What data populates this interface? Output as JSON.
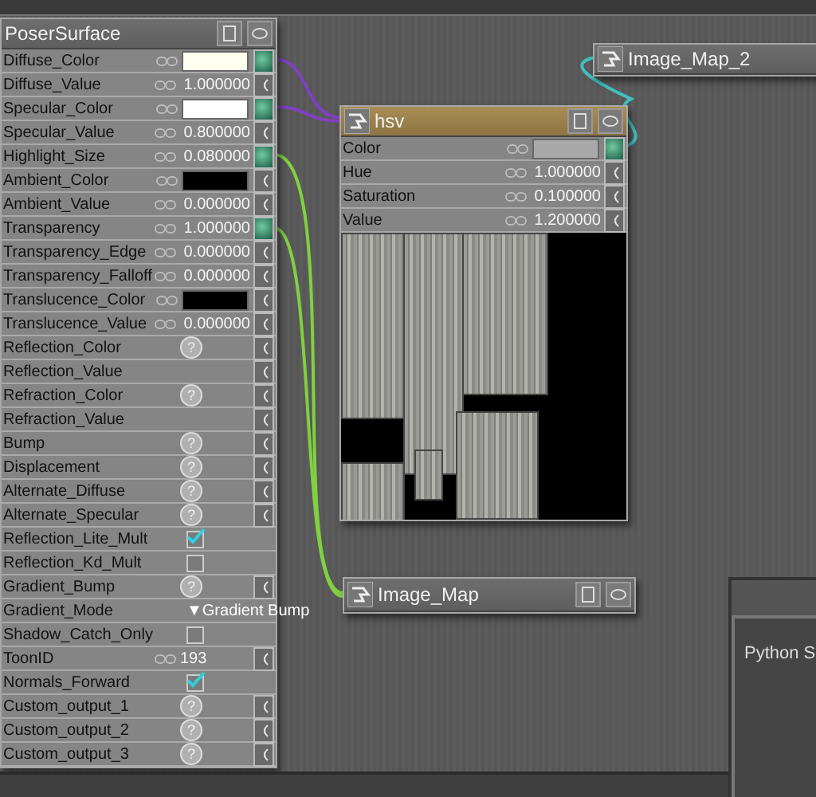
{
  "surface_node": {
    "title": "PoserSurface",
    "inputs": [
      {
        "name": "Diffuse_Color",
        "kind": "color",
        "color": "#fffff0",
        "connected": true
      },
      {
        "name": "Diffuse_Value",
        "kind": "number",
        "value": "1.000000",
        "connected": false
      },
      {
        "name": "Specular_Color",
        "kind": "color",
        "color": "#ffffff",
        "connected": true
      },
      {
        "name": "Specular_Value",
        "kind": "number",
        "value": "0.800000",
        "connected": false
      },
      {
        "name": "Highlight_Size",
        "kind": "number",
        "value": "0.080000",
        "connected": true
      },
      {
        "name": "Ambient_Color",
        "kind": "color",
        "color": "#000000",
        "connected": false
      },
      {
        "name": "Ambient_Value",
        "kind": "number",
        "value": "0.000000",
        "connected": false
      },
      {
        "name": "Transparency",
        "kind": "number",
        "value": "1.000000",
        "connected": true
      },
      {
        "name": "Transparency_Edge",
        "kind": "number",
        "value": "0.000000",
        "connected": false
      },
      {
        "name": "Transparency_Falloff",
        "kind": "number",
        "value": "0.000000",
        "connected": false
      },
      {
        "name": "Translucence_Color",
        "kind": "color",
        "color": "#000000",
        "connected": false
      },
      {
        "name": "Translucence_Value",
        "kind": "number",
        "value": "0.000000",
        "connected": false
      },
      {
        "name": "Reflection_Color",
        "kind": "help",
        "connected": false
      },
      {
        "name": "Reflection_Value",
        "kind": "empty",
        "connected": false
      },
      {
        "name": "Refraction_Color",
        "kind": "help",
        "connected": false
      },
      {
        "name": "Refraction_Value",
        "kind": "empty",
        "connected": false
      },
      {
        "name": "Bump",
        "kind": "help",
        "connected": false
      },
      {
        "name": "Displacement",
        "kind": "help",
        "connected": false
      },
      {
        "name": "Alternate_Diffuse",
        "kind": "help",
        "connected": false
      },
      {
        "name": "Alternate_Specular",
        "kind": "help",
        "connected": false
      },
      {
        "name": "Reflection_Lite_Mult",
        "kind": "checkbox",
        "checked": true
      },
      {
        "name": "Reflection_Kd_Mult",
        "kind": "checkbox",
        "checked": false
      },
      {
        "name": "Gradient_Bump",
        "kind": "help",
        "connected": false
      },
      {
        "name": "Gradient_Mode",
        "kind": "dropdown",
        "arrow": "▼",
        "value": "Gradient Bump"
      },
      {
        "name": "Shadow_Catch_Only",
        "kind": "checkbox",
        "checked": false
      },
      {
        "name": "ToonID",
        "kind": "integer",
        "value": "193",
        "connected": false
      },
      {
        "name": "Normals_Forward",
        "kind": "checkbox",
        "checked": true
      },
      {
        "name": "Custom_output_1",
        "kind": "help",
        "connected": false
      },
      {
        "name": "Custom_output_2",
        "kind": "help",
        "connected": false
      },
      {
        "name": "Custom_output_3",
        "kind": "help",
        "connected": false
      }
    ]
  },
  "hsv_node": {
    "title": "hsv",
    "inputs": [
      {
        "name": "Color",
        "kind": "color",
        "color": "#a9a9a9",
        "connected": true
      },
      {
        "name": "Hue",
        "kind": "number",
        "value": "1.000000",
        "connected": false
      },
      {
        "name": "Saturation",
        "kind": "number",
        "value": "0.100000",
        "connected": false
      },
      {
        "name": "Value",
        "kind": "number",
        "value": "1.200000",
        "connected": false
      }
    ]
  },
  "image_map_2_node": {
    "title": "Image_Map_2"
  },
  "image_map_node": {
    "title": "Image_Map"
  },
  "python_panel": {
    "title": "Python S"
  },
  "help_icon": "?"
}
